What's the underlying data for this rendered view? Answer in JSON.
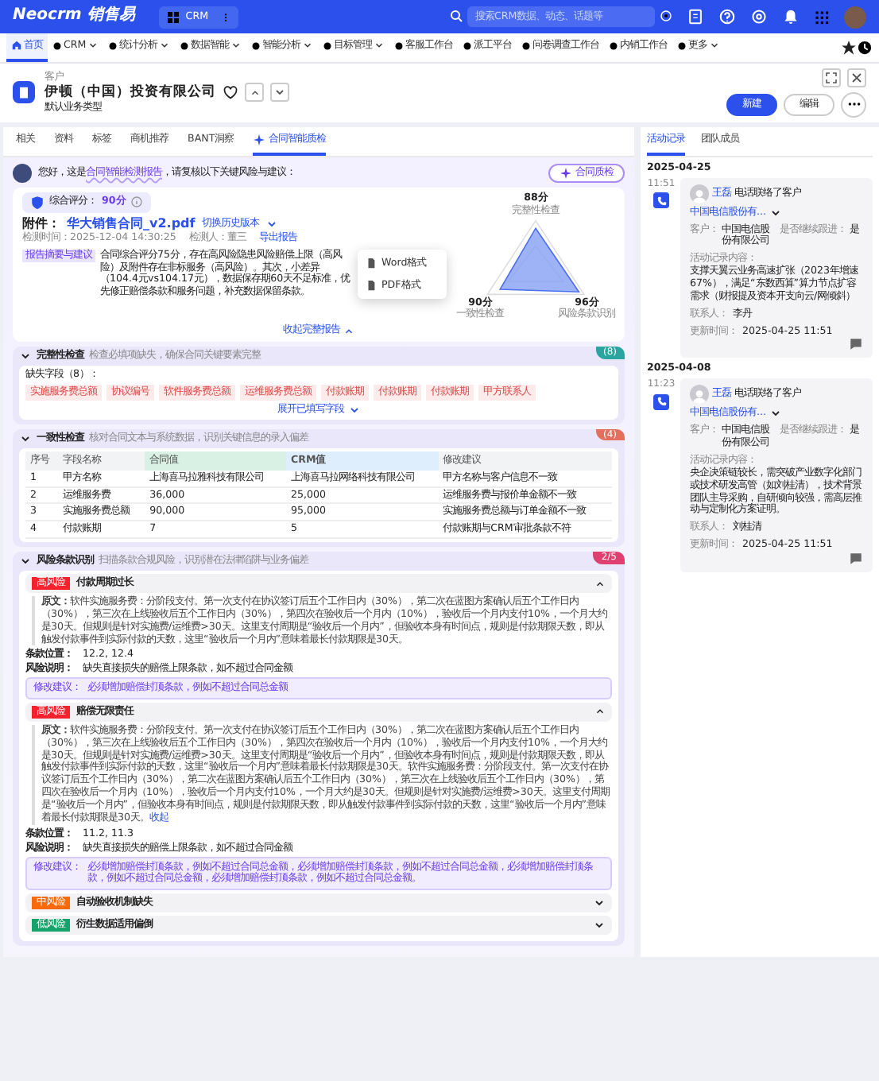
{
  "topbar": {
    "logo": "Neocrm 销售易",
    "app": "CRM",
    "search": {
      "placeholder": "搜索CRM数据、动态、话题等"
    }
  },
  "nav": [
    {
      "label": "首页",
      "selected": true,
      "dropdown": false
    },
    {
      "label": "CRM",
      "selected": false,
      "dropdown": true
    },
    {
      "label": "统计分析",
      "selected": false,
      "dropdown": true
    },
    {
      "label": "数据智能",
      "selected": false,
      "dropdown": true
    },
    {
      "label": "智能分析",
      "selected": false,
      "dropdown": true
    },
    {
      "label": "目标管理",
      "selected": false,
      "dropdown": true
    },
    {
      "label": "客服工作台",
      "selected": false,
      "dropdown": false
    },
    {
      "label": "派工平台",
      "selected": false,
      "dropdown": false
    },
    {
      "label": "问卷调查工作台",
      "selected": false,
      "dropdown": false
    },
    {
      "label": "内销工作台",
      "selected": false,
      "dropdown": false
    },
    {
      "label": "更多",
      "selected": false,
      "dropdown": true
    }
  ],
  "record": {
    "type": "客户",
    "name": "伊顿（中国）投资有限公司",
    "business_type": "默认业务类型",
    "buttons": [
      "新建",
      "编辑"
    ]
  },
  "tabs": [
    {
      "label": "相关",
      "selected": false
    },
    {
      "label": "资料",
      "selected": false
    },
    {
      "label": "标签",
      "selected": false
    },
    {
      "label": "商机推荐",
      "selected": false
    },
    {
      "label": "BANT洞察",
      "selected": false
    },
    {
      "label": "合同智能质检",
      "selected": true
    }
  ],
  "greeting": {
    "before": "您好，这是",
    "link": "合同智能检测报告",
    "after": "，请复核以下关键风险与建议：",
    "button": "合同质检"
  },
  "report": {
    "score_label": "综合评分：",
    "score": "90分",
    "attachment_label": "附件：",
    "file": "华大销售合同_v2.pdf",
    "versions": "切换历史版本",
    "time": "检测时间：2025-12-04 14:30:25",
    "inspector": "检测人：董三",
    "export": "导出报告",
    "export_menu": [
      "Word格式",
      "PDF格式"
    ],
    "summary_tag": "报告摘要与建议",
    "summary": "合同综合评分75分，存在高风险隐患风险赔偿上限（高风险）及附件存在非标服务（高风险）。其次，小差异（104.4元vs104.17元），数据保存期60天不足标准，优先修正赔偿条款和服务问题，补充数据保留条款。",
    "radar": [
      {
        "score": "88分",
        "label": "完整性检查"
      },
      {
        "score": "90分",
        "label": "一致性检查"
      },
      {
        "score": "96分",
        "label": "风险条款识别"
      }
    ],
    "collapse": "收起完整报告"
  },
  "completeness": {
    "title": "完整性检查",
    "hint": "检查必填项缺失，确保合同关键要素完整",
    "badge": "(8)",
    "missing_label": "缺失字段（8）：",
    "fields": [
      "实施服务费总额",
      "协议编号",
      "软件服务费总额",
      "运维服务费总额",
      "付款账期",
      "付款账期",
      "付款账期",
      "甲方联系人"
    ],
    "expand": "展开已填写字段"
  },
  "consistency": {
    "title": "一致性检查",
    "hint": "核对合同文本与系统数据，识别关键信息的录入偏差",
    "badge": "(4)",
    "columns": [
      "序号",
      "字段名称",
      "合同值",
      "CRM值",
      "修改建议"
    ],
    "rows": [
      [
        "1",
        "甲方名称",
        "上海喜马拉雅科技有限公司",
        "上海喜马拉网络科技有限公司",
        "甲方名称与客户信息不一致"
      ],
      [
        "2",
        "运维服务费",
        "36,000",
        "25,000",
        "运维服务费与报价单金额不一致"
      ],
      [
        "3",
        "实施服务费总额",
        "90,000",
        "95,000",
        "实施服务费总额与订单金额不一致"
      ],
      [
        "4",
        "付款账期",
        "7",
        "5",
        "付款账期与CRM审批条款不符"
      ]
    ]
  },
  "risks": {
    "title": "风险条款识别",
    "hint": "扫描条款合规风险，识别潜在法律陷阱与业务偏差",
    "badge": "2/5",
    "items": [
      {
        "level": "高风险",
        "color": "#f5222d",
        "title": "付款周期过长",
        "expanded": true,
        "source_label": "原文：",
        "source": "软件实施服务费：分阶段支付。第一次支付在协议签订后五个工作日内（30%），第二次在蓝图方案确认后五个工作日内（30%），第三次在上线验收后五个工作日内（30%），第四次在验收后一个月内（10%），验收后一个月内支付10%，一个月大约是30天。但规则是针对实施费/运维费>30天。这里支付周期是“验收后一个月内”，但验收本身有时间点，规则是付款期限天数，即从触发付款事件到实际付款的天数，这里“验收后一个月内”意味着最长付款期限是30天。",
        "position_label": "条款位置：",
        "position": "12.2, 12.4",
        "explain_label": "风险说明：",
        "explain": "缺失直接损失的赔偿上限条款，如不超过合同金额",
        "advice_label": "修改建议：",
        "advice": "必须增加赔偿封顶条款，例如不超过合同总金额"
      },
      {
        "level": "高风险",
        "color": "#f5222d",
        "title": "赔偿无限责任",
        "expanded": true,
        "source_label": "原文：",
        "source": "软件实施服务费：分阶段支付。第一次支付在协议签订后五个工作日内（30%），第二次在蓝图方案确认后五个工作日内（30%），第三次在上线验收后五个工作日内（30%），第四次在验收后一个月内（10%），验收后一个月内支付10%，一个月大约是30天。但规则是针对实施费/运维费>30天。这里支付周期是“验收后一个月内”，但验收本身有时间点，规则是付款期限天数，即从触发付款事件到实际付款的天数，这里“验收后一个月内”意味着最长付款期限是30天。软件实施服务费：分阶段支付。第一次支付在协议签订后五个工作日内（30%），第二次在蓝图方案确认后五个工作日内（30%），第三次在上线验收后五个工作日内（30%），第四次在验收后一个月内（10%），验收后一个月内支付10%，一个月大约是30天。但规则是针对实施费/运维费>30天。这里支付周期是“验收后一个月内”，但验收本身有时间点，规则是付款期限天数，即从触发付款事件到实际付款的天数，这里“验收后一个月内”意味着最长付款期限是30天。",
        "fold": "收起",
        "position_label": "条款位置：",
        "position": "11.2, 11.3",
        "explain_label": "风险说明：",
        "explain": "缺失直接损失的赔偿上限条款，如不超过合同金额",
        "advice_label": "修改建议：",
        "advice": "必须增加赔偿封顶条款，例如不超过合同总金额，必须增加赔偿封顶条款，例如不超过合同总金额，必须增加赔偿封顶条款，例如不超过合同总金额，必须增加赔偿封顶条款，例如不超过合同总金额。"
      },
      {
        "level": "中风险",
        "color": "#fa6a0a",
        "title": "自动验收机制缺失",
        "expanded": false
      },
      {
        "level": "低风险",
        "color": "#16a36b",
        "title": "衍生数据适用偏倒",
        "expanded": false
      }
    ]
  },
  "side_tabs": [
    {
      "label": "活动记录",
      "selected": true
    },
    {
      "label": "团队成员",
      "selected": false
    }
  ],
  "activities": [
    {
      "date": "2025-04-25",
      "time": "11:51",
      "user": "王磊",
      "action": "电话联络了客户",
      "customer_link": "中国电信股份有...",
      "fields": [
        {
          "label": "客户：",
          "value": "中国电信股份有限公司"
        },
        {
          "label": "是否继续跟进：",
          "value": "是"
        }
      ],
      "content_label": "活动记录内容：",
      "content": "支撑天翼云业务高速扩张（2023年增速67%），满足“东数西算”算力节点扩容需求（财报提及资本开支向云/网倾斜）",
      "contact_label": "联系人：",
      "contact": "李丹",
      "updated_label": "更新时间：",
      "updated": "2025-04-25 11:51"
    },
    {
      "date": "2025-04-08",
      "time": "11:23",
      "user": "王磊",
      "action": "电话联络了客户",
      "customer_link": "中国电信股份有...",
      "fields": [
        {
          "label": "客户：",
          "value": "中国电信股份有限公司"
        },
        {
          "label": "是否继续跟进：",
          "value": "是"
        }
      ],
      "content_label": "活动记录内容：",
      "content": "央企决策链较长，需突破产业数字化部门或技术研发高管（如刘桂清），技术背景团队主导采购，自研倾向较强，需高层推动与定制化方案证明。",
      "contact_label": "联系人：",
      "contact": "刘桂清",
      "updated_label": "更新时间：",
      "updated": "2025-04-25 11:51"
    }
  ]
}
